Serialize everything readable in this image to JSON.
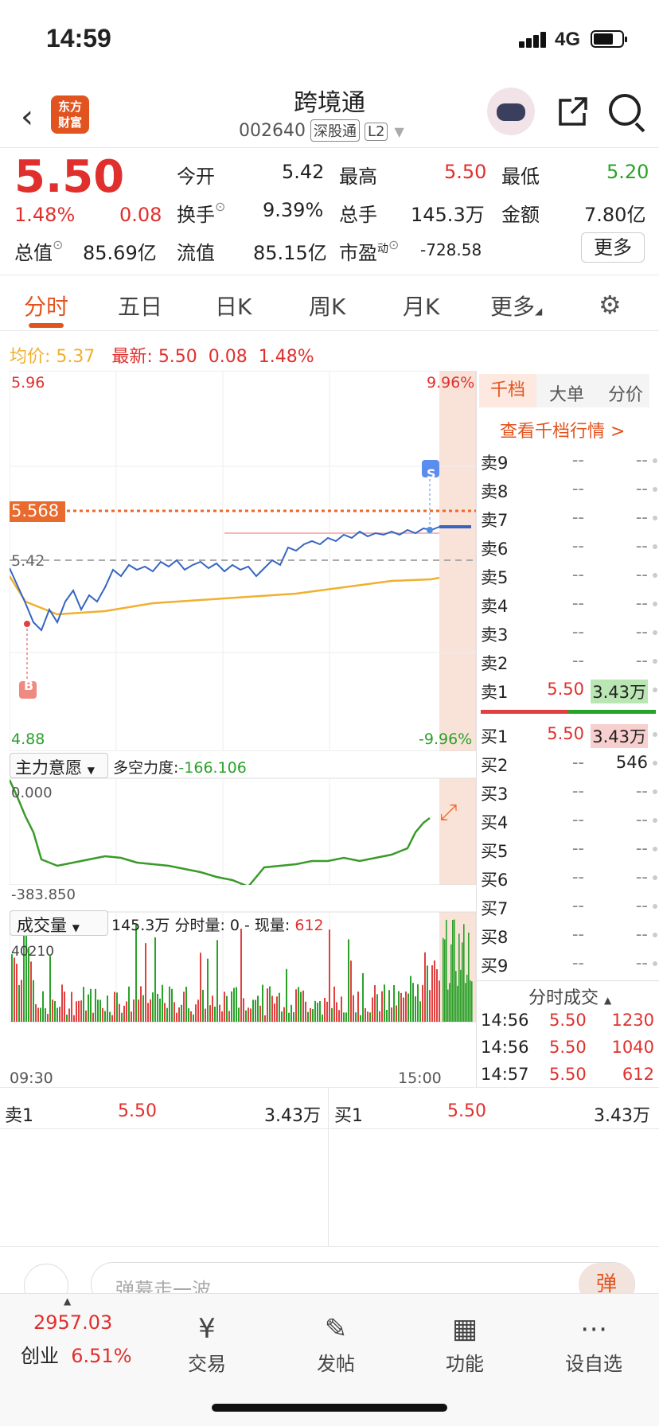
{
  "status": {
    "time": "14:59",
    "network": "4G"
  },
  "header": {
    "back": "‹",
    "logo_line1": "东方",
    "logo_line2": "财富",
    "title": "跨境通",
    "code": "002640",
    "tag1": "深股通",
    "tag2": "L2"
  },
  "quote": {
    "price": "5.50",
    "pct": "1.48%",
    "chg": "0.08",
    "open_label": "今开",
    "open": "5.42",
    "high_label": "最高",
    "high": "5.50",
    "low_label": "最低",
    "low": "5.20",
    "turnover_label": "换手",
    "turnover": "9.39%",
    "vol_label": "总手",
    "vol": "145.3万",
    "amount_label": "金额",
    "amount": "7.80亿",
    "mcap_label": "总值",
    "mcap": "85.69亿",
    "float_label": "流值",
    "float": "85.15亿",
    "pe_label": "市盈",
    "pe_sup": "动",
    "pe": "-728.58",
    "more": "更多"
  },
  "tabs": [
    "分时",
    "五日",
    "日K",
    "周K",
    "月K",
    "更多"
  ],
  "info": {
    "avg_label": "均价:",
    "avg": "5.37",
    "latest_label": "最新:",
    "latest": "5.50",
    "chg": "0.08",
    "pct": "1.48%"
  },
  "chart": {
    "ymax": "5.96",
    "ymin": "4.88",
    "pmax": "9.96%",
    "pmin": "-9.96%",
    "ref": "5.42",
    "alert": "5.568",
    "sell_mark": "S",
    "buy_mark": "B",
    "ind_label": "主力意愿",
    "ind_desc": "多空力度:",
    "ind_val": "-166.106",
    "ind_top": "0.000",
    "ind_bottom": "-383.850",
    "vol_label": "成交量",
    "vol_total": "145.3万",
    "vol_desc": "分时量: 0 - 现量:",
    "vol_now": "612",
    "vol_max": "40210",
    "t_start": "09:30",
    "t_end": "15:00"
  },
  "depth": {
    "tabs": [
      "千档",
      "大单",
      "分价"
    ],
    "link": "查看千档行情 >",
    "sells": [
      {
        "l": "卖9",
        "p": "--",
        "v": "--"
      },
      {
        "l": "卖8",
        "p": "--",
        "v": "--"
      },
      {
        "l": "卖7",
        "p": "--",
        "v": "--"
      },
      {
        "l": "卖6",
        "p": "--",
        "v": "--"
      },
      {
        "l": "卖5",
        "p": "--",
        "v": "--"
      },
      {
        "l": "卖4",
        "p": "--",
        "v": "--"
      },
      {
        "l": "卖3",
        "p": "--",
        "v": "--"
      },
      {
        "l": "卖2",
        "p": "--",
        "v": "--"
      },
      {
        "l": "卖1",
        "p": "5.50",
        "v": "3.43万"
      }
    ],
    "buys": [
      {
        "l": "买1",
        "p": "5.50",
        "v": "3.43万"
      },
      {
        "l": "买2",
        "p": "--",
        "v": "546"
      },
      {
        "l": "买3",
        "p": "--",
        "v": "--"
      },
      {
        "l": "买4",
        "p": "--",
        "v": "--"
      },
      {
        "l": "买5",
        "p": "--",
        "v": "--"
      },
      {
        "l": "买6",
        "p": "--",
        "v": "--"
      },
      {
        "l": "买7",
        "p": "--",
        "v": "--"
      },
      {
        "l": "买8",
        "p": "--",
        "v": "--"
      },
      {
        "l": "买9",
        "p": "--",
        "v": "--"
      }
    ],
    "ticks_label": "分时成交",
    "ticks": [
      {
        "t": "14:56",
        "p": "5.50",
        "v": "1230"
      },
      {
        "t": "14:56",
        "p": "5.50",
        "v": "1040"
      },
      {
        "t": "14:57",
        "p": "5.50",
        "v": "612"
      }
    ]
  },
  "level1": {
    "sell_label": "卖1",
    "sell_p": "5.50",
    "sell_v": "3.43万",
    "buy_label": "买1",
    "buy_p": "5.50",
    "buy_v": "3.43万"
  },
  "danmu": {
    "placeholder": "弹幕走一波...",
    "btn": "弹"
  },
  "nav": {
    "index": "2957.03",
    "index_name": "创业",
    "index_pct": "6.51%",
    "items": [
      "交易",
      "发帖",
      "功能",
      "设自选"
    ]
  },
  "colors": {
    "up": "#e0302d",
    "down": "#2aa22a",
    "accent": "#e2541f",
    "avg_line": "#f0b030",
    "price_line": "#3565c0"
  }
}
